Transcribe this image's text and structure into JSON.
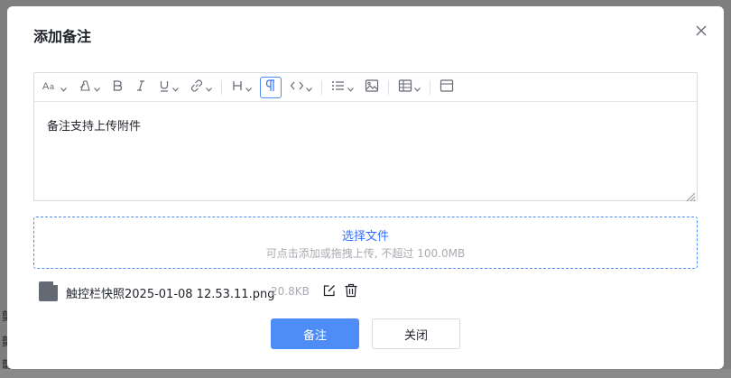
{
  "dialog": {
    "title": "添加备注"
  },
  "editor": {
    "toolbar": [
      {
        "name": "font-size-icon",
        "dropdown": true
      },
      {
        "name": "text-color-icon",
        "dropdown": true
      },
      {
        "name": "bold-icon",
        "dropdown": false
      },
      {
        "name": "italic-icon",
        "dropdown": false
      },
      {
        "name": "underline-icon",
        "dropdown": true
      },
      {
        "name": "link-icon",
        "dropdown": true
      },
      {
        "name": "heading-icon",
        "dropdown": true
      },
      {
        "name": "paragraph-icon",
        "dropdown": false,
        "active": true
      },
      {
        "name": "code-icon",
        "dropdown": true
      },
      {
        "name": "list-icon",
        "dropdown": true
      },
      {
        "name": "image-icon",
        "dropdown": false
      },
      {
        "name": "table-icon",
        "dropdown": true
      },
      {
        "name": "block-icon",
        "dropdown": false
      }
    ],
    "content": "备注支持上传附件"
  },
  "upload": {
    "link_text": "选择文件",
    "hint": "可点击添加或拖拽上传, 不超过 100.0MB"
  },
  "attachment": {
    "icon": "file-icon",
    "file_name": "触控栏快照2025-01-08 12.53.11.png",
    "file_size": "20.8KB"
  },
  "buttons": {
    "submit_label": "备注",
    "close_label": "关闭"
  },
  "colors": {
    "accent": "#4d8df5",
    "link": "#3370ff",
    "hint": "#a8abb2",
    "overlay": "#7f7f7f"
  }
}
